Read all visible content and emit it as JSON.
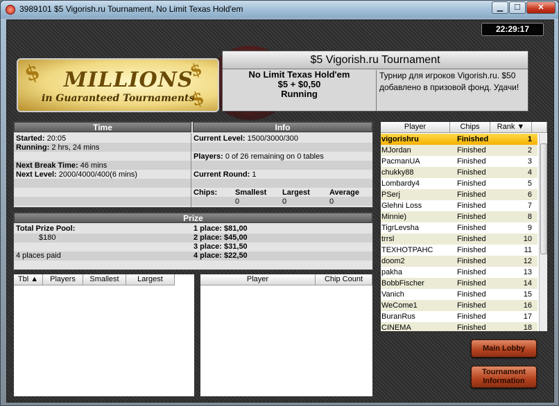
{
  "window": {
    "title": "3989101 $5 Vigorish.ru Tournament, No Limit Texas Hold'em",
    "minimize": "▁",
    "maximize": "☐",
    "close": "✕"
  },
  "clock": "22:29:17",
  "logo": {
    "big": "MILLIONS",
    "small": "in Guaranteed Tournaments"
  },
  "tournament": {
    "title": "$5 Vigorish.ru Tournament",
    "game": "No Limit Texas Hold'em",
    "buyin": "$5 + $0,50",
    "status": "Running",
    "description": "Турнир для игроков Vigorish.ru. $50 добавлено в призовой фонд. Удачи!"
  },
  "time_panel": {
    "header": "Time",
    "started_label": "Started:",
    "started_value": "20:05",
    "running_label": "Running:",
    "running_value": "2 hrs, 24 mins",
    "next_break_label": "Next Break Time:",
    "next_break_value": "46 mins",
    "next_level_label": "Next Level:",
    "next_level_value": "2000/4000/400(6 mins)"
  },
  "info_panel": {
    "header": "Info",
    "current_level_label": "Current Level:",
    "current_level_value": "1500/3000/300",
    "players_label": "Players:",
    "players_value": "0 of 26 remaining on 0 tables",
    "current_round_label": "Current Round:",
    "current_round_value": "1",
    "chips_label": "Chips:",
    "smallest_label": "Smallest",
    "largest_label": "Largest",
    "average_label": "Average",
    "smallest_value": "0",
    "largest_value": "0",
    "average_value": "0"
  },
  "prize_panel": {
    "header": "Prize",
    "total_label": "Total Prize Pool:",
    "total_value": "$180",
    "places_paid": "4 places paid",
    "places": [
      {
        "label": "1 place:",
        "value": "$81,00"
      },
      {
        "label": "2 place:",
        "value": "$45,00"
      },
      {
        "label": "3 place:",
        "value": "$31,50"
      },
      {
        "label": "4 place:",
        "value": "$22,50"
      }
    ]
  },
  "tables_list": {
    "columns": [
      "Tbl",
      "Players",
      "Smallest",
      "Largest"
    ],
    "sort_arrow": "▲"
  },
  "table_players_list": {
    "columns": [
      "Player",
      "Chip Count"
    ]
  },
  "players_list": {
    "columns": [
      "Player",
      "Chips",
      "Rank"
    ],
    "sort_arrow": "▼",
    "rows": [
      {
        "name": "vigorishru",
        "status": "Finished",
        "rank": "1"
      },
      {
        "name": "MJordan",
        "status": "Finished",
        "rank": "2"
      },
      {
        "name": "PacmanUA",
        "status": "Finished",
        "rank": "3"
      },
      {
        "name": "chukky88",
        "status": "Finished",
        "rank": "4"
      },
      {
        "name": "Lombardy4",
        "status": "Finished",
        "rank": "5"
      },
      {
        "name": "PSerj",
        "status": "Finished",
        "rank": "6"
      },
      {
        "name": "Glehni Loss",
        "status": "Finished",
        "rank": "7"
      },
      {
        "name": "Minnie)",
        "status": "Finished",
        "rank": "8"
      },
      {
        "name": "TigrLevsha",
        "status": "Finished",
        "rank": "9"
      },
      {
        "name": "trrsl",
        "status": "Finished",
        "rank": "10"
      },
      {
        "name": "TEXHOTPAHC",
        "status": "Finished",
        "rank": "11"
      },
      {
        "name": "doom2",
        "status": "Finished",
        "rank": "12"
      },
      {
        "name": "pakha",
        "status": "Finished",
        "rank": "13"
      },
      {
        "name": "BobbFischer",
        "status": "Finished",
        "rank": "14"
      },
      {
        "name": "Vanich",
        "status": "Finished",
        "rank": "15"
      },
      {
        "name": "WeCome1",
        "status": "Finished",
        "rank": "16"
      },
      {
        "name": "BuranRus",
        "status": "Finished",
        "rank": "17"
      },
      {
        "name": "CINEMA",
        "status": "Finished",
        "rank": "18"
      }
    ]
  },
  "buttons": {
    "main_lobby": "Main Lobby",
    "tournament_info_1": "Tournament",
    "tournament_info_2": "Information"
  }
}
